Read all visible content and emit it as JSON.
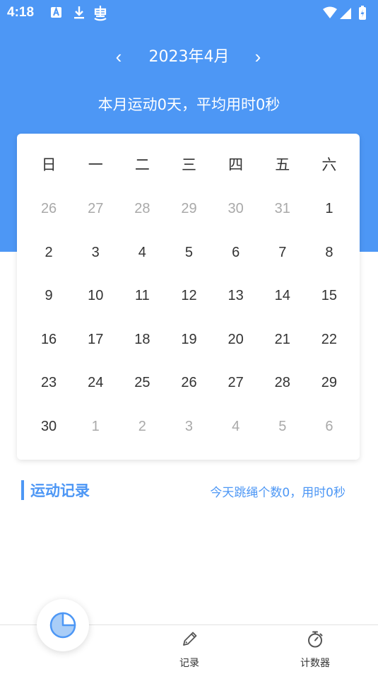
{
  "statusbar": {
    "time": "4:18"
  },
  "header": {
    "prev_arrow": "‹",
    "next_arrow": "›",
    "month_title": "2023年4月",
    "summary": "本月运动0天，平均用时0秒"
  },
  "calendar": {
    "weekdays": [
      "日",
      "一",
      "二",
      "三",
      "四",
      "五",
      "六"
    ],
    "weeks": [
      [
        {
          "d": "26",
          "o": true
        },
        {
          "d": "27",
          "o": true
        },
        {
          "d": "28",
          "o": true
        },
        {
          "d": "29",
          "o": true
        },
        {
          "d": "30",
          "o": true
        },
        {
          "d": "31",
          "o": true
        },
        {
          "d": "1",
          "o": false
        }
      ],
      [
        {
          "d": "2",
          "o": false
        },
        {
          "d": "3",
          "o": false
        },
        {
          "d": "4",
          "o": false
        },
        {
          "d": "5",
          "o": false
        },
        {
          "d": "6",
          "o": false
        },
        {
          "d": "7",
          "o": false
        },
        {
          "d": "8",
          "o": false
        }
      ],
      [
        {
          "d": "9",
          "o": false
        },
        {
          "d": "10",
          "o": false
        },
        {
          "d": "11",
          "o": false
        },
        {
          "d": "12",
          "o": false
        },
        {
          "d": "13",
          "o": false
        },
        {
          "d": "14",
          "o": false
        },
        {
          "d": "15",
          "o": false
        }
      ],
      [
        {
          "d": "16",
          "o": false
        },
        {
          "d": "17",
          "o": false
        },
        {
          "d": "18",
          "o": false
        },
        {
          "d": "19",
          "o": false
        },
        {
          "d": "20",
          "o": false
        },
        {
          "d": "21",
          "o": false
        },
        {
          "d": "22",
          "o": false
        }
      ],
      [
        {
          "d": "23",
          "o": false
        },
        {
          "d": "24",
          "o": false
        },
        {
          "d": "25",
          "o": false
        },
        {
          "d": "26",
          "o": false
        },
        {
          "d": "27",
          "o": false
        },
        {
          "d": "28",
          "o": false
        },
        {
          "d": "29",
          "o": false
        }
      ],
      [
        {
          "d": "30",
          "o": false
        },
        {
          "d": "1",
          "o": true
        },
        {
          "d": "2",
          "o": true
        },
        {
          "d": "3",
          "o": true
        },
        {
          "d": "4",
          "o": true
        },
        {
          "d": "5",
          "o": true
        },
        {
          "d": "6",
          "o": true
        }
      ]
    ]
  },
  "records": {
    "title": "运动记录",
    "summary": "今天跳绳个数0，用时0秒"
  },
  "bottom_nav": {
    "fab_icon": "pie-chart-icon",
    "tabs": [
      {
        "label": "记录",
        "icon": "pencil-icon"
      },
      {
        "label": "计数器",
        "icon": "stopwatch-icon"
      }
    ]
  },
  "colors": {
    "primary": "#4d97f5",
    "text": "#333333",
    "muted": "#a9a9a9",
    "background": "#ffffff"
  }
}
